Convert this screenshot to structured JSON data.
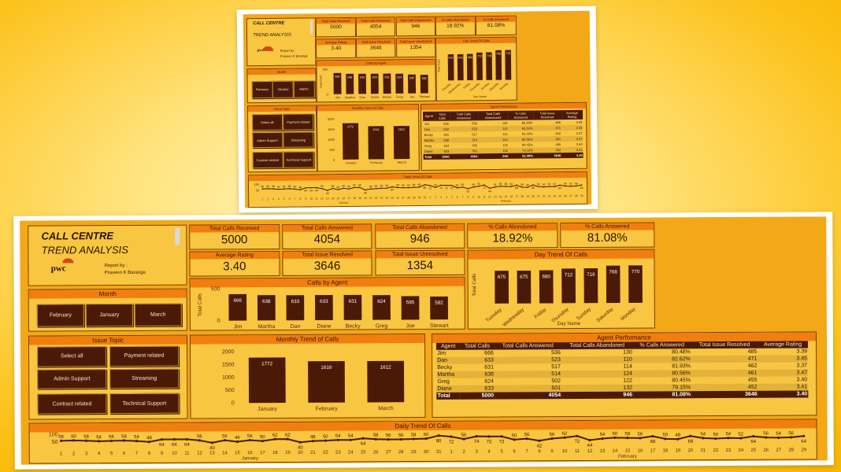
{
  "title": {
    "line1": "CALL CENTRE",
    "line2": "TREND ANALYSIS"
  },
  "brand": {
    "logo_text": "pwc",
    "report_by": "Report by :",
    "author": "Praveen K Barange"
  },
  "kpis": [
    {
      "label": "Total Calls Received",
      "value": "5000"
    },
    {
      "label": "Total Calls Answered",
      "value": "4054"
    },
    {
      "label": "Total Calls Abandoned",
      "value": "946"
    },
    {
      "label": "% Calls Abondoned",
      "value": "18.92%"
    },
    {
      "label": "% Calls Answered",
      "value": "81.08%"
    },
    {
      "label": "Average Rating",
      "value": "3.40"
    },
    {
      "label": "Total Issue Resolved",
      "value": "3646"
    },
    {
      "label": "Total Issue Unresolved",
      "value": "1354"
    }
  ],
  "month_slicer": {
    "title": "Month",
    "options": [
      "February",
      "January",
      "March"
    ]
  },
  "issue_slicer": {
    "title": "Issue Topic",
    "options": [
      "Select all",
      "Payment related",
      "Admin Support",
      "Streaming",
      "Contract related",
      "Technical Support"
    ]
  },
  "table": {
    "title": "Agent Performance",
    "headers": [
      "Agent",
      "Total Calls",
      "Total Calls Answered",
      "Total Calls Abandoned",
      "% Calls Answered",
      "Total Issue Resolved",
      "Average Rating"
    ],
    "rows": [
      [
        "Jim",
        "666",
        "536",
        "130",
        "80.48%",
        "485",
        "3.39"
      ],
      [
        "Dan",
        "633",
        "523",
        "110",
        "82.62%",
        "471",
        "3.45"
      ],
      [
        "Becky",
        "631",
        "517",
        "114",
        "81.93%",
        "462",
        "3.37"
      ],
      [
        "Martha",
        "638",
        "514",
        "124",
        "80.56%",
        "461",
        "3.47"
      ],
      [
        "Greg",
        "624",
        "502",
        "122",
        "80.45%",
        "455",
        "3.40"
      ],
      [
        "Diane",
        "633",
        "501",
        "132",
        "79.15%",
        "452",
        "3.41"
      ]
    ],
    "total": [
      "Total",
      "5000",
      "4054",
      "946",
      "81.08%",
      "3646",
      "3.40"
    ]
  },
  "chart_data": [
    {
      "id": "day_trend",
      "type": "bar",
      "title": "Day Trend Of Calls",
      "xlabel": "Day Name",
      "ylabel": "Total Calls",
      "categories": [
        "Tuesday",
        "Wednesday",
        "Friday",
        "Thursday",
        "Sunday",
        "Saturday",
        "Monday"
      ],
      "values": [
        675,
        675,
        680,
        712,
        716,
        768,
        770
      ]
    },
    {
      "id": "calls_by_agent",
      "type": "bar",
      "title": "Calls by Agent",
      "ylabel": "Total Calls",
      "categories": [
        "Jim",
        "Martha",
        "Dan",
        "Diane",
        "Becky",
        "Greg",
        "Joe",
        "Stewart"
      ],
      "values": [
        666,
        638,
        633,
        633,
        631,
        624,
        595,
        582
      ],
      "yticks": [
        0,
        500
      ]
    },
    {
      "id": "monthly_trend",
      "type": "bar",
      "title": "Monthly Trend of Calls",
      "categories": [
        "January",
        "February",
        "March"
      ],
      "values": [
        1772,
        1616,
        1612
      ],
      "yticks": [
        0,
        500,
        1000,
        1500,
        2000
      ]
    },
    {
      "id": "daily_trend",
      "type": "line",
      "title": "Daily Trend Of Calls",
      "yticks": [
        50,
        100
      ],
      "x": [
        "1",
        "2",
        "3",
        "4",
        "5",
        "6",
        "7",
        "8",
        "9",
        "10",
        "11",
        "12",
        "13",
        "14",
        "15",
        "16",
        "17",
        "18",
        "19",
        "20",
        "21",
        "22",
        "23",
        "24",
        "25",
        "26",
        "27",
        "28",
        "29",
        "30",
        "31",
        "1",
        "2",
        "3",
        "4",
        "5",
        "6",
        "7",
        "8",
        "9",
        "10",
        "11",
        "12",
        "13",
        "14",
        "15",
        "16",
        "17",
        "18",
        "19",
        "20",
        "21",
        "22",
        "23",
        "24",
        "25",
        "26",
        "27",
        "28",
        "29"
      ],
      "values": [
        58,
        60,
        58,
        54,
        56,
        58,
        54,
        48,
        64,
        64,
        64,
        56,
        40,
        56,
        46,
        56,
        50,
        62,
        62,
        40,
        48,
        50,
        54,
        54,
        64,
        58,
        56,
        56,
        58,
        60,
        80,
        72,
        56,
        74,
        72,
        72,
        50,
        56,
        42,
        56,
        62,
        72,
        44,
        54,
        60,
        58,
        56,
        68,
        50,
        48,
        68,
        54,
        50,
        54,
        52,
        64,
        56,
        54,
        56,
        64
      ],
      "groups": [
        "January",
        "February"
      ]
    }
  ]
}
